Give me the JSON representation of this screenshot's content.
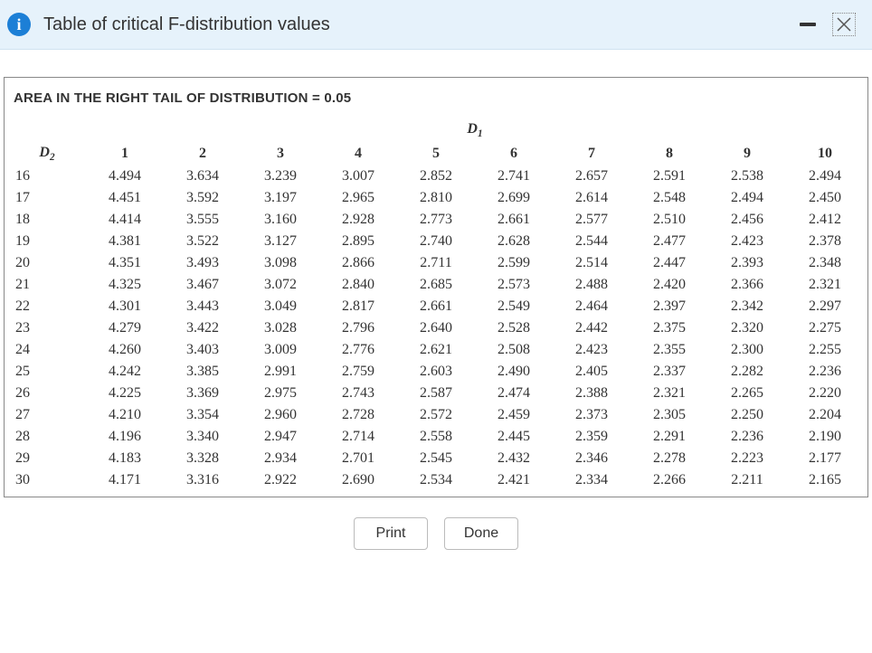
{
  "header": {
    "info_glyph": "i",
    "title": "Table of critical F-distribution values"
  },
  "area_title": "AREA IN THE RIGHT TAIL OF DISTRIBUTION = 0.05",
  "d1_label": "D",
  "d1_sub": "1",
  "d2_label": "D",
  "d2_sub": "2",
  "footer": {
    "print": "Print",
    "done": "Done"
  },
  "chart_data": {
    "type": "table",
    "title": "Critical F-distribution values, right-tail area = 0.05",
    "col_label": "D1 (numerator df)",
    "row_label": "D2 (denominator df)",
    "columns": [
      "1",
      "2",
      "3",
      "4",
      "5",
      "6",
      "7",
      "8",
      "9",
      "10"
    ],
    "rows": [
      "16",
      "17",
      "18",
      "19",
      "20",
      "21",
      "22",
      "23",
      "24",
      "25",
      "26",
      "27",
      "28",
      "29",
      "30"
    ],
    "values": [
      [
        4.494,
        3.634,
        3.239,
        3.007,
        2.852,
        2.741,
        2.657,
        2.591,
        2.538,
        2.494
      ],
      [
        4.451,
        3.592,
        3.197,
        2.965,
        2.81,
        2.699,
        2.614,
        2.548,
        2.494,
        2.45
      ],
      [
        4.414,
        3.555,
        3.16,
        2.928,
        2.773,
        2.661,
        2.577,
        2.51,
        2.456,
        2.412
      ],
      [
        4.381,
        3.522,
        3.127,
        2.895,
        2.74,
        2.628,
        2.544,
        2.477,
        2.423,
        2.378
      ],
      [
        4.351,
        3.493,
        3.098,
        2.866,
        2.711,
        2.599,
        2.514,
        2.447,
        2.393,
        2.348
      ],
      [
        4.325,
        3.467,
        3.072,
        2.84,
        2.685,
        2.573,
        2.488,
        2.42,
        2.366,
        2.321
      ],
      [
        4.301,
        3.443,
        3.049,
        2.817,
        2.661,
        2.549,
        2.464,
        2.397,
        2.342,
        2.297
      ],
      [
        4.279,
        3.422,
        3.028,
        2.796,
        2.64,
        2.528,
        2.442,
        2.375,
        2.32,
        2.275
      ],
      [
        4.26,
        3.403,
        3.009,
        2.776,
        2.621,
        2.508,
        2.423,
        2.355,
        2.3,
        2.255
      ],
      [
        4.242,
        3.385,
        2.991,
        2.759,
        2.603,
        2.49,
        2.405,
        2.337,
        2.282,
        2.236
      ],
      [
        4.225,
        3.369,
        2.975,
        2.743,
        2.587,
        2.474,
        2.388,
        2.321,
        2.265,
        2.22
      ],
      [
        4.21,
        3.354,
        2.96,
        2.728,
        2.572,
        2.459,
        2.373,
        2.305,
        2.25,
        2.204
      ],
      [
        4.196,
        3.34,
        2.947,
        2.714,
        2.558,
        2.445,
        2.359,
        2.291,
        2.236,
        2.19
      ],
      [
        4.183,
        3.328,
        2.934,
        2.701,
        2.545,
        2.432,
        2.346,
        2.278,
        2.223,
        2.177
      ],
      [
        4.171,
        3.316,
        2.922,
        2.69,
        2.534,
        2.421,
        2.334,
        2.266,
        2.211,
        2.165
      ]
    ]
  }
}
